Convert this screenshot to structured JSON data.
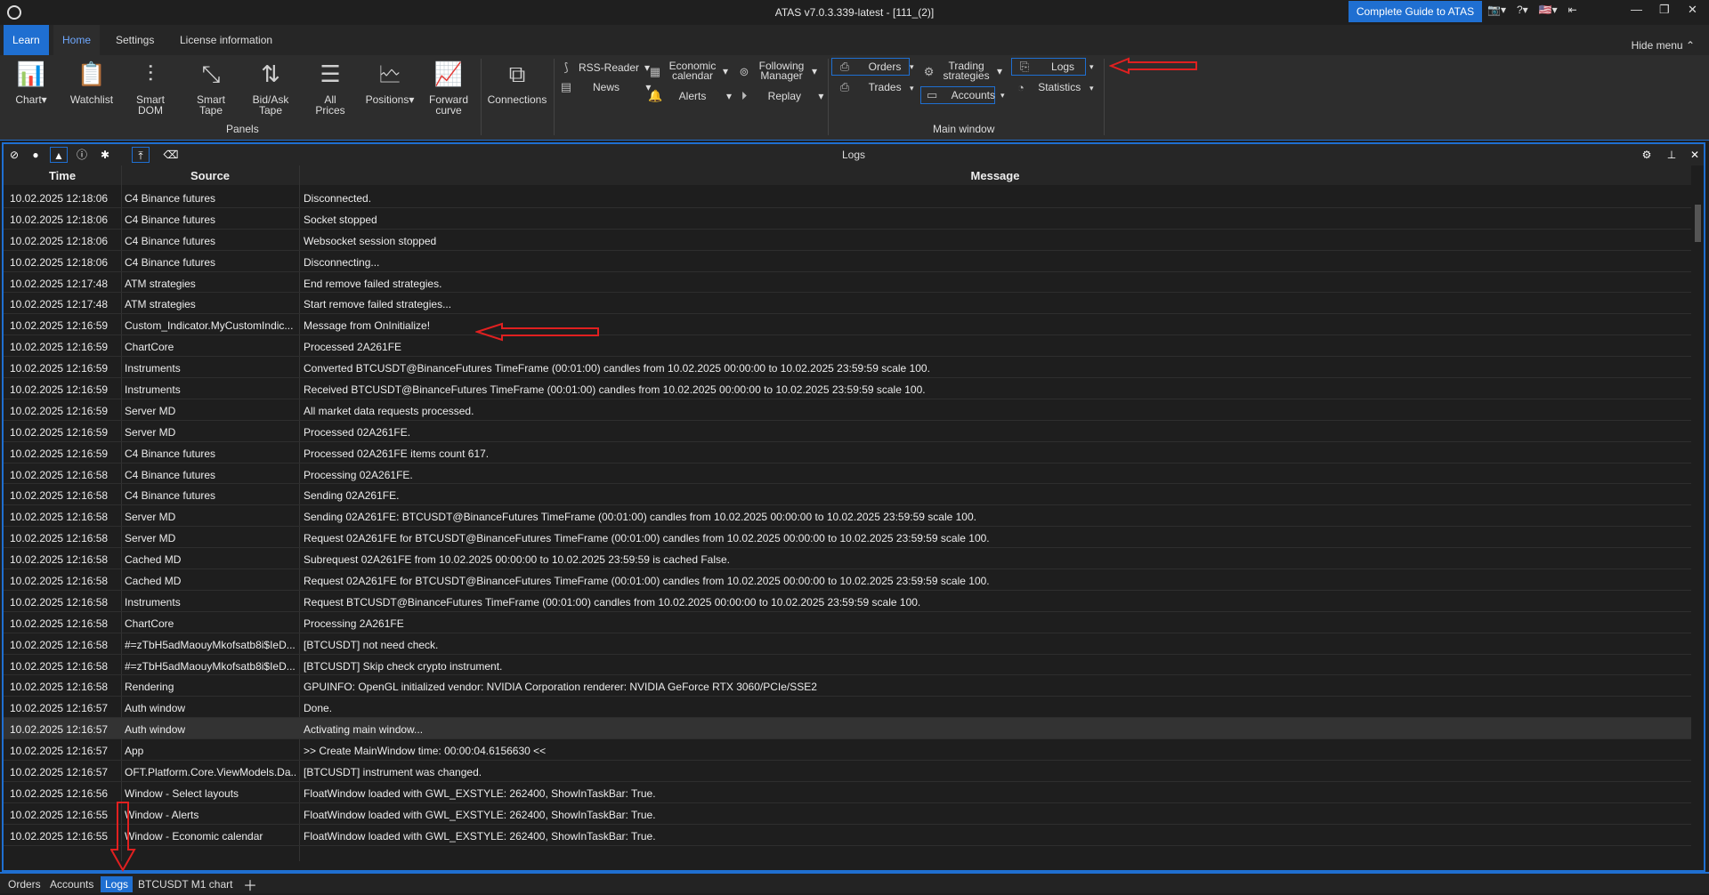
{
  "window": {
    "title": "ATAS v7.0.3.339-latest - [111_(2)]",
    "guide_button": "Complete Guide to ATAS"
  },
  "menu_tabs": [
    "Learn",
    "Home",
    "Settings",
    "License information"
  ],
  "hide_menu": "Hide menu",
  "ribbon": {
    "panels_buttons": [
      {
        "label": "Chart",
        "icon": "chart-icon"
      },
      {
        "label": "Watchlist",
        "icon": "watchlist-icon"
      },
      {
        "label": "Smart DOM",
        "icon": "smart-dom-icon"
      },
      {
        "label": "Smart Tape",
        "icon": "smart-tape-icon"
      },
      {
        "label": "Bid/Ask Tape",
        "icon": "bid-ask-tape-icon"
      },
      {
        "label": "All Prices",
        "icon": "all-prices-icon"
      },
      {
        "label": "Positions",
        "icon": "positions-icon"
      },
      {
        "label": "Forward curve",
        "icon": "forward-curve-icon"
      }
    ],
    "panels_group_label": "Panels",
    "connections": "Connections",
    "small": {
      "rss": "RSS-Reader",
      "news": "News",
      "economic": "Economic calendar",
      "alerts": "Alerts",
      "following": "Following Manager",
      "replay": "Replay",
      "orders": "Orders",
      "trades": "Trades",
      "trading_strategies": "Trading strategies",
      "accounts": "Accounts",
      "logs": "Logs",
      "statistics": "Statistics"
    },
    "main_window_label": "Main window"
  },
  "logs_panel": {
    "title": "Logs",
    "columns": [
      "Time",
      "Source",
      "Message"
    ],
    "rows": [
      [
        "10.02.2025 12:18:06",
        "C4 Binance futures",
        "Disconnected."
      ],
      [
        "10.02.2025 12:18:06",
        "C4 Binance futures",
        "Socket stopped"
      ],
      [
        "10.02.2025 12:18:06",
        "C4 Binance futures",
        "Websocket session stopped"
      ],
      [
        "10.02.2025 12:18:06",
        "C4 Binance futures",
        "Disconnecting..."
      ],
      [
        "10.02.2025 12:17:48",
        "ATM strategies",
        "End remove failed strategies."
      ],
      [
        "10.02.2025 12:17:48",
        "ATM strategies",
        "Start remove failed strategies..."
      ],
      [
        "10.02.2025 12:16:59",
        "Custom_Indicator.MyCustomIndic...",
        "Message from OnInitialize!"
      ],
      [
        "10.02.2025 12:16:59",
        "ChartCore",
        "Processed 2A261FE"
      ],
      [
        "10.02.2025 12:16:59",
        "Instruments",
        "Converted BTCUSDT@BinanceFutures TimeFrame (00:01:00) candles from 10.02.2025 00:00:00 to 10.02.2025 23:59:59 scale 100."
      ],
      [
        "10.02.2025 12:16:59",
        "Instruments",
        "Received BTCUSDT@BinanceFutures TimeFrame (00:01:00) candles from 10.02.2025 00:00:00 to 10.02.2025 23:59:59 scale 100."
      ],
      [
        "10.02.2025 12:16:59",
        "Server MD",
        "All market data requests processed."
      ],
      [
        "10.02.2025 12:16:59",
        "Server MD",
        "Processed 02A261FE."
      ],
      [
        "10.02.2025 12:16:59",
        "C4 Binance futures",
        "Processed 02A261FE items count 617."
      ],
      [
        "10.02.2025 12:16:58",
        "C4 Binance futures",
        "Processing 02A261FE."
      ],
      [
        "10.02.2025 12:16:58",
        "C4 Binance futures",
        "Sending 02A261FE."
      ],
      [
        "10.02.2025 12:16:58",
        "Server MD",
        "Sending 02A261FE: BTCUSDT@BinanceFutures TimeFrame (00:01:00) candles from 10.02.2025 00:00:00 to 10.02.2025 23:59:59 scale 100."
      ],
      [
        "10.02.2025 12:16:58",
        "Server MD",
        "Request 02A261FE for BTCUSDT@BinanceFutures TimeFrame (00:01:00) candles from 10.02.2025 00:00:00 to 10.02.2025 23:59:59 scale 100."
      ],
      [
        "10.02.2025 12:16:58",
        "Cached MD",
        "Subrequest 02A261FE from 10.02.2025 00:00:00 to 10.02.2025 23:59:59 is cached False."
      ],
      [
        "10.02.2025 12:16:58",
        "Cached MD",
        "Request 02A261FE for BTCUSDT@BinanceFutures TimeFrame (00:01:00) candles from 10.02.2025 00:00:00 to 10.02.2025 23:59:59 scale 100."
      ],
      [
        "10.02.2025 12:16:58",
        "Instruments",
        "Request BTCUSDT@BinanceFutures TimeFrame (00:01:00) candles from 10.02.2025 00:00:00 to 10.02.2025 23:59:59 scale 100."
      ],
      [
        "10.02.2025 12:16:58",
        "ChartCore",
        "Processing 2A261FE"
      ],
      [
        "10.02.2025 12:16:58",
        "#=zTbH5adMaouyMkofsatb8i$IeD...",
        "[BTCUSDT] not need check."
      ],
      [
        "10.02.2025 12:16:58",
        "#=zTbH5adMaouyMkofsatb8i$IeD...",
        "[BTCUSDT] Skip check crypto instrument."
      ],
      [
        "10.02.2025 12:16:58",
        "Rendering",
        "GPUINFO: OpenGL initialized vendor: NVIDIA Corporation renderer: NVIDIA GeForce RTX 3060/PCIe/SSE2"
      ],
      [
        "10.02.2025 12:16:57",
        "Auth window",
        "Done."
      ],
      [
        "10.02.2025 12:16:57",
        "Auth window",
        "Activating main window..."
      ],
      [
        "10.02.2025 12:16:57",
        "App",
        ">> Create MainWindow time: 00:00:04.6156630 <<"
      ],
      [
        "10.02.2025 12:16:57",
        "OFT.Platform.Core.ViewModels.Da...",
        "[BTCUSDT] instrument was changed."
      ],
      [
        "10.02.2025 12:16:56",
        "Window - Select layouts",
        "FloatWindow loaded with GWL_EXSTYLE: 262400, ShowInTaskBar: True."
      ],
      [
        "10.02.2025 12:16:55",
        "Window - Alerts",
        "FloatWindow loaded with GWL_EXSTYLE: 262400, ShowInTaskBar: True."
      ],
      [
        "10.02.2025 12:16:55",
        "Window - Economic calendar",
        "FloatWindow loaded with GWL_EXSTYLE: 262400, ShowInTaskBar: True."
      ]
    ],
    "selected_row": 25
  },
  "bottom_tabs": [
    "Orders",
    "Accounts",
    "Logs",
    "BTCUSDT M1 chart"
  ],
  "active_bottom_tab": "Logs",
  "colors": {
    "accent": "#1f6fd1",
    "annotation_arrow": "#e02020"
  }
}
